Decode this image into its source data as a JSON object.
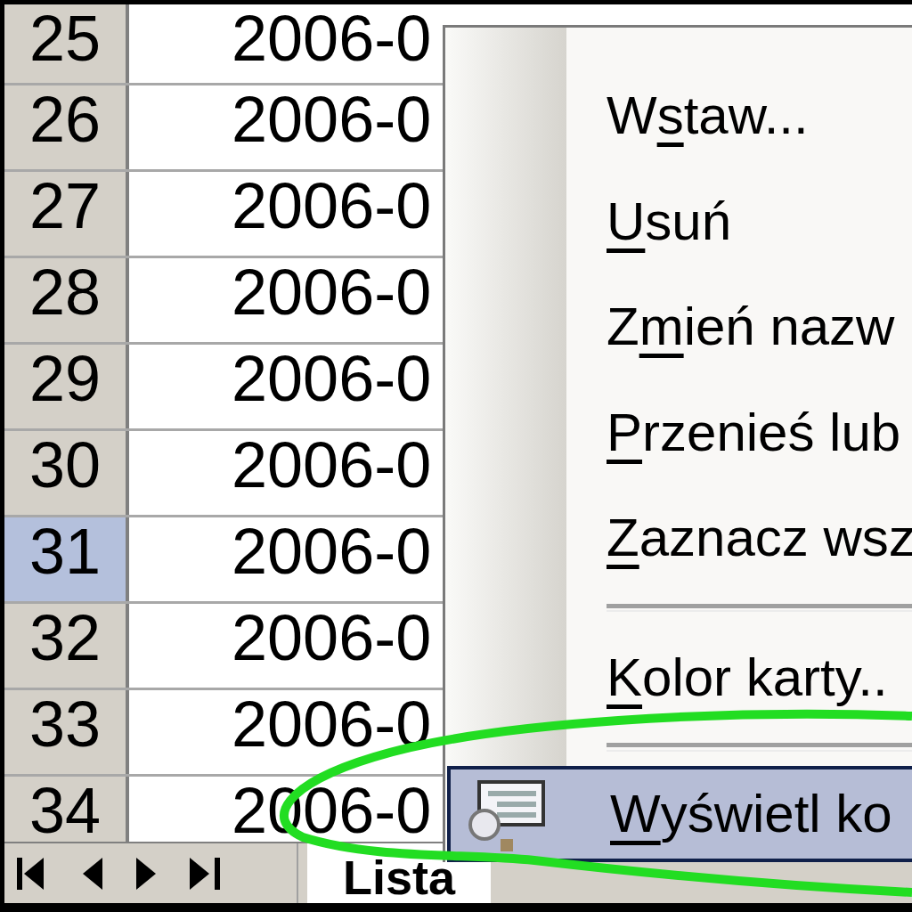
{
  "rows": [
    {
      "number": "25",
      "selected": false,
      "value": "2006-0"
    },
    {
      "number": "26",
      "selected": false,
      "value": "2006-0"
    },
    {
      "number": "27",
      "selected": false,
      "value": "2006-0"
    },
    {
      "number": "28",
      "selected": false,
      "value": "2006-0"
    },
    {
      "number": "29",
      "selected": false,
      "value": "2006-0"
    },
    {
      "number": "30",
      "selected": false,
      "value": "2006-0"
    },
    {
      "number": "31",
      "selected": true,
      "value": "2006-0"
    },
    {
      "number": "32",
      "selected": false,
      "value": "2006-0"
    },
    {
      "number": "33",
      "selected": false,
      "value": "2006-0"
    },
    {
      "number": "34",
      "selected": false,
      "value": "2006-0"
    }
  ],
  "sheet_tabs": [
    {
      "label": "Lista",
      "selected": true
    }
  ],
  "context_menu": {
    "items": [
      {
        "kind": "item",
        "before": "W",
        "key": "s",
        "after": "taw...",
        "highlighted": false
      },
      {
        "kind": "item",
        "key": "U",
        "after": "suń",
        "highlighted": false
      },
      {
        "kind": "item",
        "before": "Z",
        "key": "m",
        "after": "ień nazw",
        "highlighted": false
      },
      {
        "kind": "item",
        "key": "P",
        "after": "rzenieś lub",
        "highlighted": false
      },
      {
        "kind": "item",
        "key": "Z",
        "after": "aznacz wsz",
        "highlighted": false
      },
      {
        "kind": "separator"
      },
      {
        "kind": "item",
        "key": "K",
        "after": "olor karty..",
        "highlighted": false
      },
      {
        "kind": "separator"
      },
      {
        "kind": "icon_item",
        "key": "W",
        "after": "yświetl ko",
        "highlighted": true
      }
    ]
  }
}
